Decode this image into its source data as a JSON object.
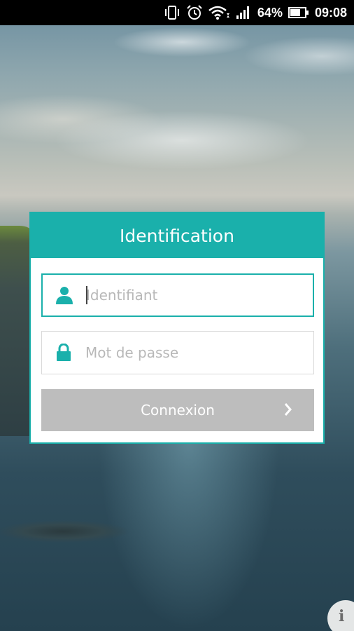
{
  "status_bar": {
    "battery_percent": "64%",
    "time": "09:08",
    "icons": [
      "vibrate-icon",
      "alarm-icon",
      "wifi-icon",
      "signal-icon",
      "battery-icon"
    ]
  },
  "login": {
    "title": "Identification",
    "username_placeholder": "Identifiant",
    "username_value": "",
    "password_placeholder": "Mot de passe",
    "password_value": "",
    "submit_label": "Connexion",
    "submit_icon": "chevron-right-icon"
  },
  "info_button": {
    "label": "i"
  },
  "colors": {
    "accent": "#1ab0ab",
    "button_disabled": "#bdbdbd"
  }
}
